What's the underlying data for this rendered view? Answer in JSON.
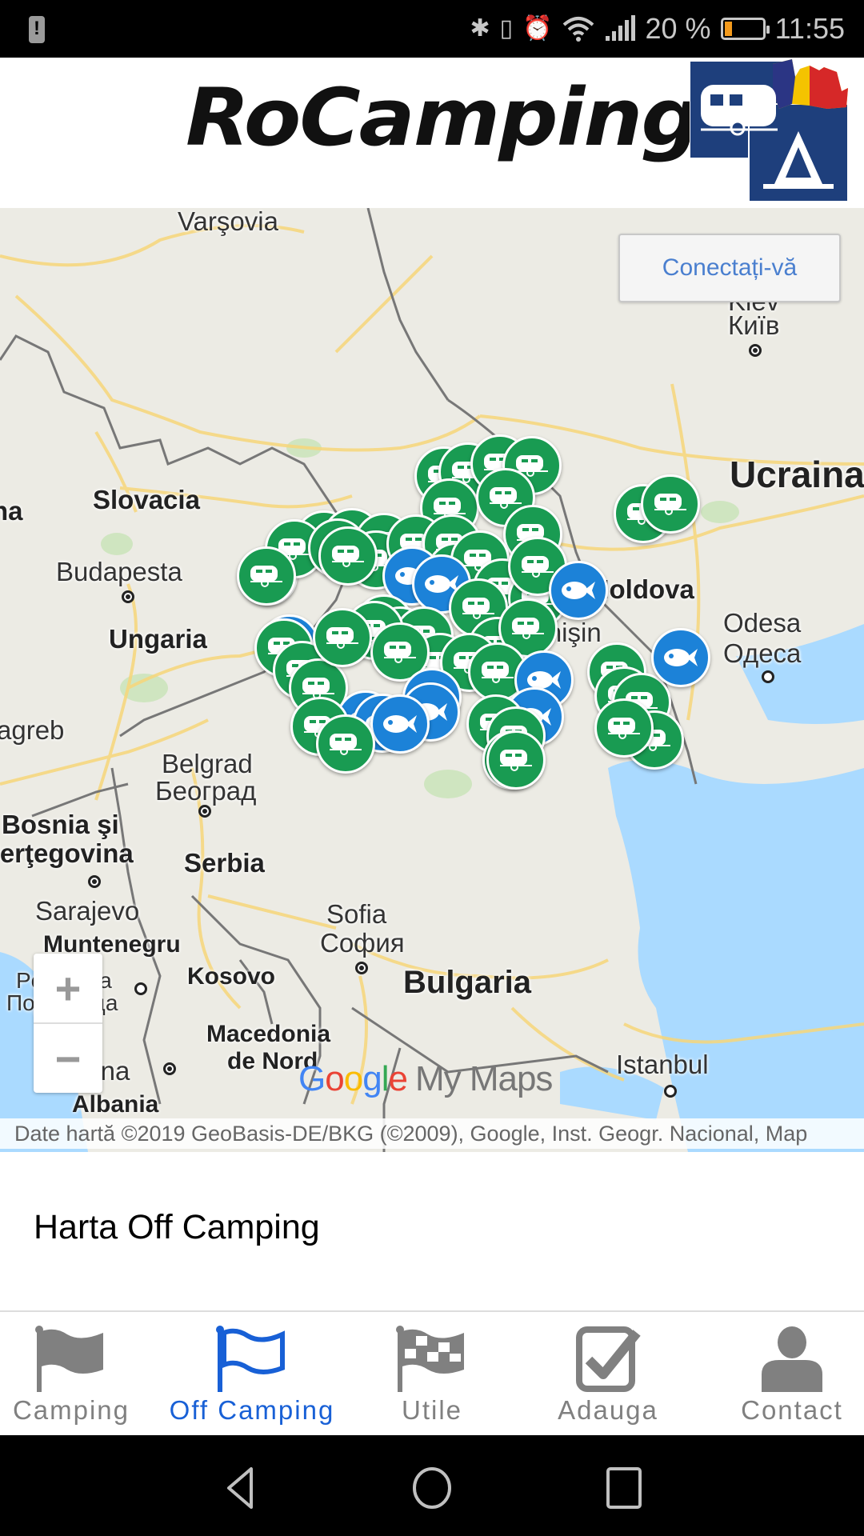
{
  "status_bar": {
    "time": "11:55",
    "battery_percent_text": "20 %",
    "battery_level": 0.2,
    "icons": [
      "warning-icon",
      "bluetooth-icon",
      "vibrate-icon",
      "alarm-icon",
      "wifi-icon",
      "signal-icon",
      "battery-icon"
    ]
  },
  "header": {
    "title": "RoCamping",
    "logo": "rocamping-logo"
  },
  "map": {
    "login_button": "Conectați-vă",
    "labels": {
      "warsaw": "Varşovia",
      "kyiv_lat": "Kiev",
      "kyiv_cyr": "Київ",
      "ukraine": "Ucraina",
      "slovakia": "Slovacia",
      "budapest": "Budapesta",
      "hungary": "Ungaria",
      "moldova": "Moldova",
      "chisinau": "Chişin",
      "odesa_lat": "Odesa",
      "odesa_cyr": "Одеса",
      "zagreb": "agreb",
      "belgrade_lat": "Belgrad",
      "belgrade_cyr": "Београд",
      "bosnia_1": "Bosnia şi",
      "bosnia_2": "Herţegovina",
      "serbia": "Serbia",
      "sarajevo": "Sarajevo",
      "montenegro": "Muntenegru",
      "sofia_lat": "Sofia",
      "sofia_cyr": "София",
      "kosovo": "Kosovo",
      "bulgaria": "Bulgaria",
      "macedonia_1": "Macedonia",
      "macedonia_2": "de Nord",
      "tirana": "Tirana",
      "albania": "Albania",
      "istanbul": "Istanbul",
      "podgorica_1": "Podgoriţa",
      "podgorica_2": "Подгорица",
      "ina": "na"
    },
    "zoom_in": "+",
    "zoom_out": "−",
    "google_logo": [
      "G",
      "o",
      "o",
      "g",
      "l",
      "e"
    ],
    "my_maps": "My Maps",
    "attribution": "Date hartă ©2019 GeoBasis-DE/BKG (©2009), Google, Inst. Geogr. Nacional, Map",
    "marker_types": {
      "camp": "caravan-icon",
      "fish": "fish-icon"
    },
    "marker_colors": {
      "camp": "#199b52",
      "fish": "#1c82d8"
    }
  },
  "content": {
    "heading": "Harta Off Camping"
  },
  "tabs": [
    {
      "label": "Camping",
      "icon": "flag-filled-icon",
      "active": false
    },
    {
      "label": "Off Camping",
      "icon": "flag-outline-icon",
      "active": true
    },
    {
      "label": "Utile",
      "icon": "checkered-flag-icon",
      "active": false
    },
    {
      "label": "Adauga",
      "icon": "checkbox-icon",
      "active": false
    },
    {
      "label": "Contact",
      "icon": "user-icon",
      "active": false
    }
  ],
  "colors": {
    "active_tab": "#1860d6",
    "inactive_tab": "#808080",
    "login_text": "#4a7fcf"
  }
}
